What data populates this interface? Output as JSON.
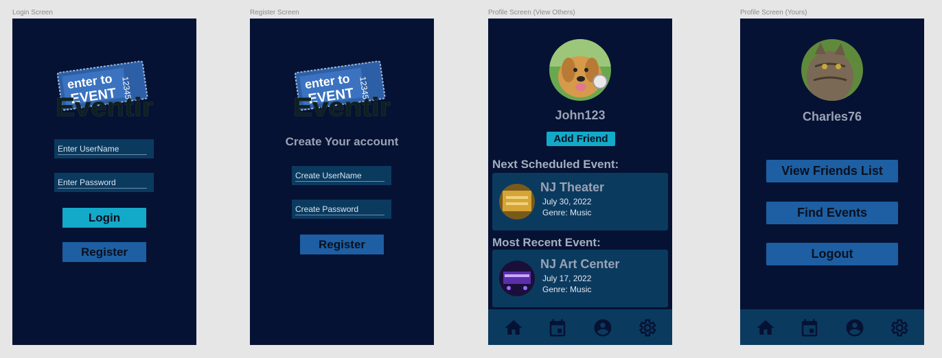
{
  "frames": {
    "login": {
      "label": "Login Screen",
      "username_placeholder": "Enter UserName",
      "password_placeholder": "Enter Password",
      "login_label": "Login",
      "register_label": "Register"
    },
    "register": {
      "label": "Register Screen",
      "heading": "Create Your account",
      "username_placeholder": "Create UserName",
      "password_placeholder": "Create Password",
      "register_label": "Register"
    },
    "profile_others": {
      "label": "Profile Screen (View Others)",
      "username": "John123",
      "add_friend_label": "Add Friend",
      "next_heading": "Next Scheduled Event:",
      "next_event": {
        "title": "NJ Theater",
        "date": "July 30, 2022",
        "genre": "Genre: Music"
      },
      "recent_heading": "Most Recent Event:",
      "recent_event": {
        "title": "NJ Art Center",
        "date": "July 17, 2022",
        "genre": "Genre: Music"
      }
    },
    "profile_yours": {
      "label": "Profile Screen (Yours)",
      "username": "Charles76",
      "view_friends_label": "View Friends List",
      "find_events_label": "Find Events",
      "logout_label": "Logout"
    }
  },
  "logo": {
    "ticket_text": "enter to",
    "ticket_sub": "EVENT",
    "ticket_number": "12345",
    "brand": "Eventir"
  },
  "nav_icons": [
    "home-icon",
    "calendar-icon",
    "account-icon",
    "gear-icon"
  ],
  "colors": {
    "background": "#061233",
    "panel": "#0b3a5f",
    "cyan": "#13a9c8",
    "blue": "#1d5fa2"
  }
}
